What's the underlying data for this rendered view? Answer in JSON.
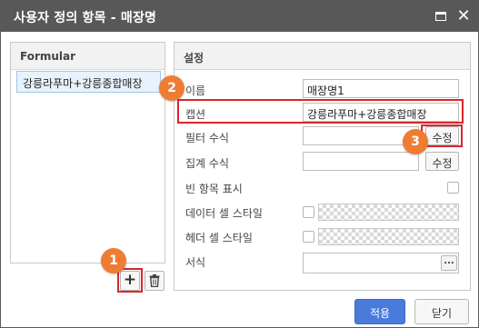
{
  "window": {
    "title": "사용자 정의 항목 - 매장명",
    "maximize_icon": "maximize-icon",
    "close_icon": "close-icon",
    "close_glyph": "✕"
  },
  "left_panel": {
    "header": "Formular",
    "items": [
      {
        "label": "강릉라푸마+강릉종합매장",
        "selected": true
      }
    ],
    "add_glyph": "+",
    "add_icon": "plus-icon",
    "delete_icon": "trash-icon"
  },
  "settings": {
    "header": "설정",
    "name": {
      "label": "이름",
      "value": "매장명1"
    },
    "caption": {
      "label": "캡션",
      "value": "강릉라푸마+강릉종합매장"
    },
    "filter_formula": {
      "label": "필터 수식",
      "value": "",
      "button": "수정"
    },
    "aggregate_formula": {
      "label": "집계 수식",
      "value": "",
      "button": "수정"
    },
    "show_empty": {
      "label": "빈 항목 표시",
      "checked": false
    },
    "data_cell_style": {
      "label": "데이터 셀 스타일",
      "checked": false
    },
    "header_cell_style": {
      "label": "헤더 셀 스타일",
      "checked": false
    },
    "format": {
      "label": "서식",
      "value": "",
      "button": "..."
    }
  },
  "badges": [
    "1",
    "2",
    "3"
  ],
  "footer": {
    "apply": "적용",
    "close": "닫기"
  },
  "colors": {
    "titlebar": "#585858",
    "highlight": "#d9262c",
    "badge": "#ee7d33",
    "primary": "#4a7bdb"
  }
}
